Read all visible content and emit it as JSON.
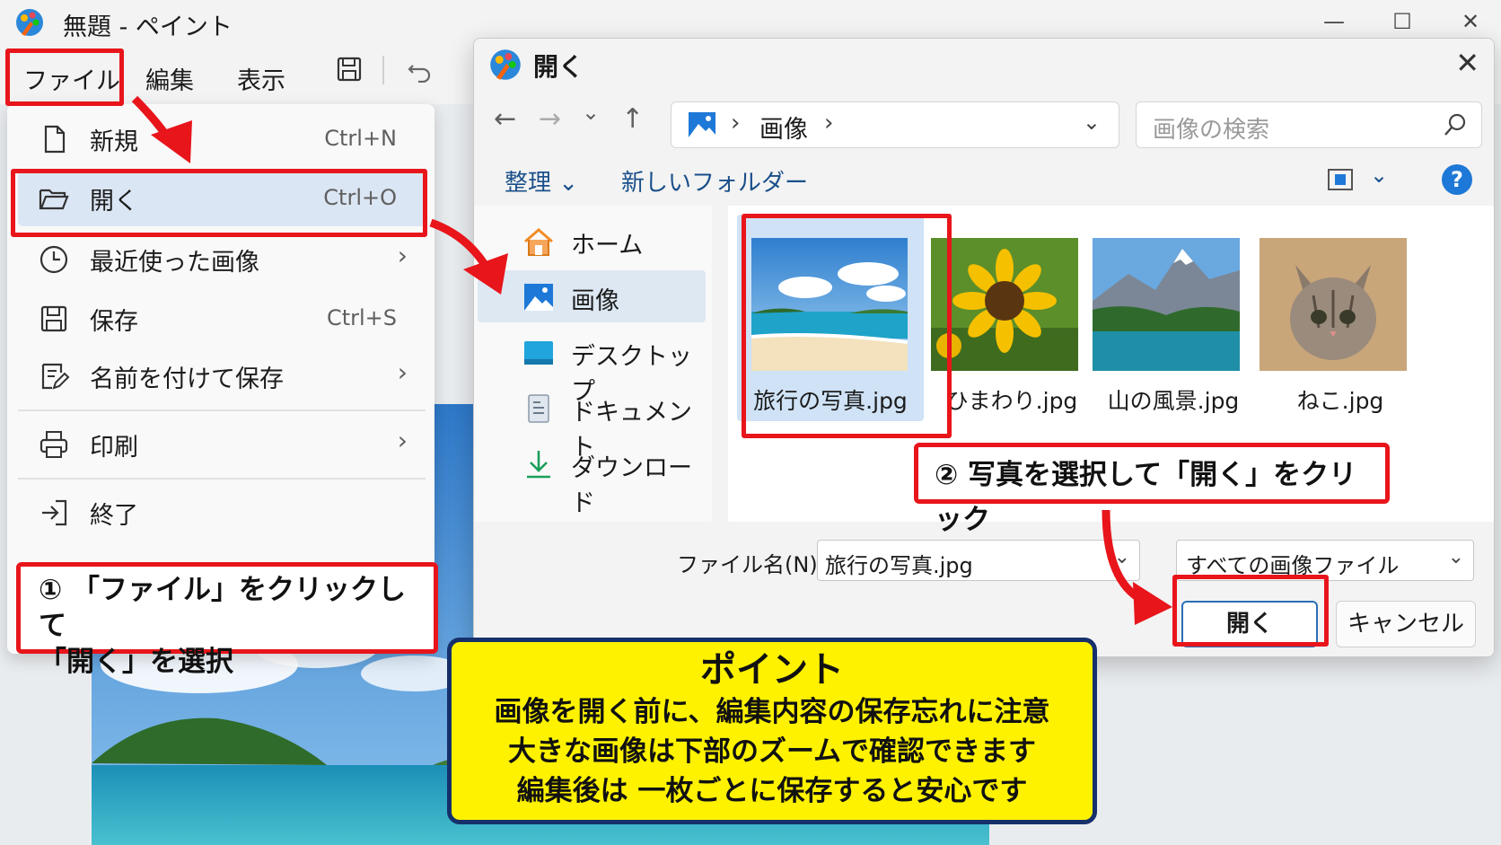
{
  "paint": {
    "title": "無題 - ペイント",
    "window_controls": {
      "minimize": "—",
      "maximize": "☐",
      "close": "✕"
    },
    "menus": {
      "file": "ファイル",
      "edit": "編集",
      "view": "表示"
    }
  },
  "file_menu": {
    "items": [
      {
        "label": "新規",
        "shortcut": "Ctrl+N"
      },
      {
        "label": "開く",
        "shortcut": "Ctrl+O"
      },
      {
        "label": "最近使った画像",
        "chevron": "›"
      },
      {
        "label": "保存",
        "shortcut": "Ctrl+S"
      },
      {
        "label": "名前を付けて保存",
        "chevron": "›"
      },
      {
        "label": "印刷",
        "chevron": "›"
      },
      {
        "label": "終了"
      }
    ]
  },
  "dialog": {
    "title": "開く",
    "close": "✕",
    "nav_buttons": {
      "back": "←",
      "forward": "→",
      "recent": "⌄",
      "up": "↑"
    },
    "address": {
      "sep": "›",
      "crumb": "画像",
      "dropdown": "⌄"
    },
    "search_placeholder": "画像の検索",
    "commands": {
      "organize": "整理 ⌄",
      "new_folder": "新しいフォルダー",
      "view_dropdown": "⌄",
      "help": "?"
    },
    "nav_items": [
      {
        "label": "ホーム",
        "icon": "home-icon"
      },
      {
        "label": "画像",
        "icon": "pictures-icon"
      },
      {
        "label": "デスクトップ",
        "icon": "desktop-icon"
      },
      {
        "label": "ドキュメント",
        "icon": "document-icon"
      },
      {
        "label": "ダウンロード",
        "icon": "download-icon"
      }
    ],
    "files": [
      {
        "name": "旅行の写真.jpg",
        "thumb": "beach"
      },
      {
        "name": "ひまわり.jpg",
        "thumb": "sunflower"
      },
      {
        "name": "山の風景.jpg",
        "thumb": "mountain"
      },
      {
        "name": "ねこ.jpg",
        "thumb": "kitten"
      }
    ],
    "footer": {
      "filename_label": "ファイル名(N):",
      "filename_value": "旅行の写真.jpg",
      "filter_value": "すべての画像ファイル",
      "dropdown": "⌄",
      "open_button": "開く",
      "cancel_button": "キャンセル"
    }
  },
  "annotations": {
    "callout1_line1": "① 「ファイル」をクリックして",
    "callout1_line2": "「開く」を選択",
    "callout2": "② 写真を選択して「開く」をクリック",
    "point_title": "ポイント",
    "point_lines": [
      "画像を開く前に、編集内容の保存忘れに注意",
      "大きな画像は下部のズームで確認できます",
      "編集後は 一枚ごとに保存すると安心です"
    ]
  },
  "colors": {
    "accent_red": "#e8151b",
    "point_yellow": "#fff200",
    "point_border": "#16306b",
    "link_blue": "#1a4f8a"
  }
}
